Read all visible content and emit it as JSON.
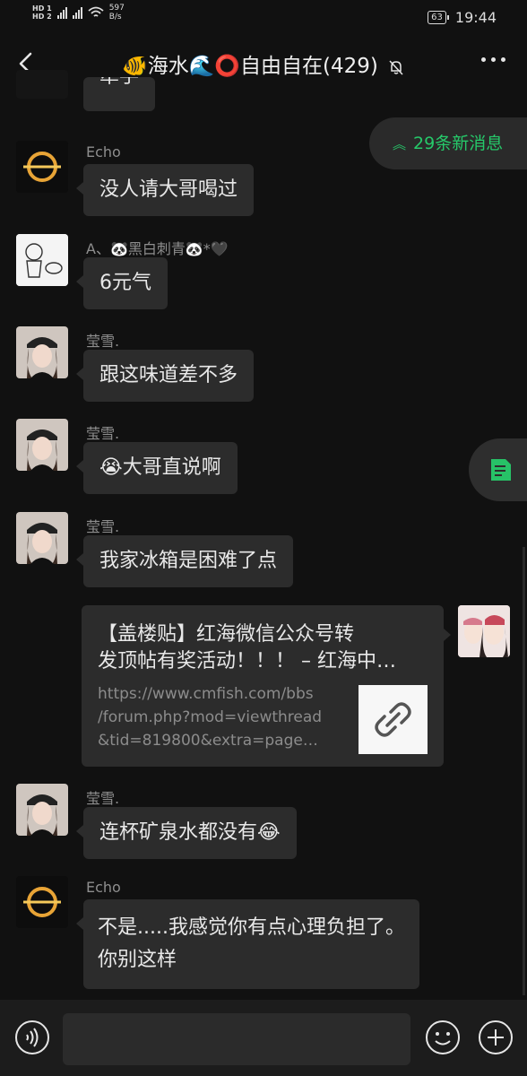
{
  "status": {
    "net_speed": "597",
    "speed_unit": "B/s",
    "battery": "63",
    "time": "19:44"
  },
  "header": {
    "title": "🐠海水🌊⭕自由自在(429)"
  },
  "new_messages": "29条新消息",
  "messages": [
    {
      "text": "牵手"
    },
    {
      "sender": "Echo",
      "text": "没人请大哥喝过"
    },
    {
      "sender": "A、🐼黑白刺青🐼*🖤",
      "text": "6元气"
    },
    {
      "sender": "莹雪.",
      "text": "跟这味道差不多"
    },
    {
      "sender": "莹雪.",
      "text": "😭大哥直说啊"
    },
    {
      "sender": "莹雪.",
      "text": "我家冰箱是困难了点"
    },
    {
      "sender": "莹雪.",
      "text": "连杯矿泉水都没有😂"
    },
    {
      "sender": "Echo",
      "line1": "不是.....我感觉你有点心理负担了。",
      "line2": "你别这样"
    }
  ],
  "link_card": {
    "title_line1": "【盖楼贴】红海微信公众号转",
    "title_line2": "发顶帖有奖活动！！！ – 红海中…",
    "url": "https://www.cmfish.com/bbs\n/forum.php?mod=viewthread\n&tid=819800&extra=page…"
  },
  "colors": {
    "accent": "#26c96a",
    "bubble": "#2c2c2c",
    "background": "#111111"
  }
}
